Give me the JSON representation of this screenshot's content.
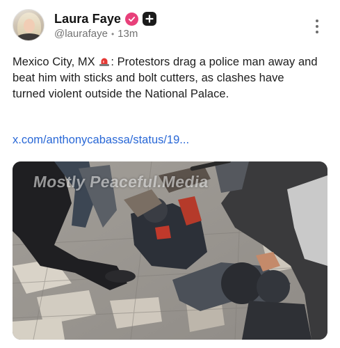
{
  "author": {
    "display_name": "Laura Faye",
    "handle": "@laurafaye",
    "separator": "•",
    "time_ago": "13m",
    "verified": true,
    "badge_color": "#e8407a"
  },
  "icons": {
    "menu": "more-vertical-icon",
    "verified": "verified-badge-icon",
    "plus": "plus-badge-icon",
    "siren": "rotating-light-icon"
  },
  "post": {
    "text_before": "Mexico City, MX ",
    "text_after": ": Protestors drag a police man away and beat him with sticks and bolt cutters, as clashes have turned violent outside the National Palace.",
    "link_text": "x.com/anthonycabassa/status/19...",
    "link_color": "#2867d6"
  },
  "media": {
    "watermark": "Mostly Peaceful.Media"
  }
}
